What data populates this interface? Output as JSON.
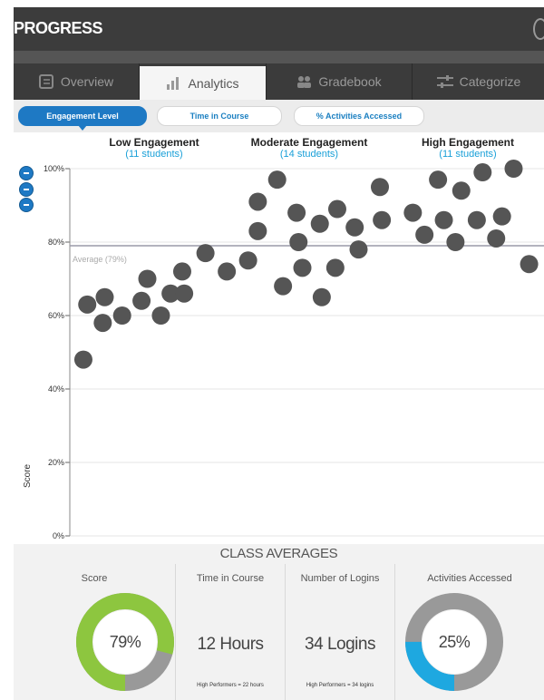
{
  "app": {
    "title": "PROGRESS"
  },
  "tabs": [
    {
      "label": "Overview",
      "icon": "overview-icon",
      "active": false
    },
    {
      "label": "Analytics",
      "icon": "bar-chart-icon",
      "active": true
    },
    {
      "label": "Gradebook",
      "icon": "people-icon",
      "active": false
    },
    {
      "label": "Categorize",
      "icon": "sliders-icon",
      "active": false
    }
  ],
  "filters": [
    {
      "label": "Engagement Level",
      "active": true
    },
    {
      "label": "Time in Course",
      "active": false
    },
    {
      "label": "% Activities Accessed",
      "active": false
    }
  ],
  "groups": [
    {
      "name": "Low Engagement",
      "count": "(11 students)"
    },
    {
      "name": "Moderate Engagement",
      "count": "(14 students)"
    },
    {
      "name": "High Engagement",
      "count": "(11 students)"
    }
  ],
  "chart_data": {
    "type": "scatter",
    "ylabel": "Score",
    "ylim": [
      0,
      100
    ],
    "yticks": [
      "100%",
      "80%",
      "60%",
      "40%",
      "20%",
      "0%"
    ],
    "average": {
      "label": "Average (79%)",
      "value": 79
    },
    "point_color": "#555555",
    "series": [
      {
        "group": "Low Engagement",
        "points": [
          {
            "x": 1,
            "y": 48
          },
          {
            "x": 1.2,
            "y": 63
          },
          {
            "x": 2,
            "y": 58
          },
          {
            "x": 2.1,
            "y": 65
          },
          {
            "x": 3,
            "y": 60
          },
          {
            "x": 4,
            "y": 64
          },
          {
            "x": 4.3,
            "y": 70
          },
          {
            "x": 5,
            "y": 60
          },
          {
            "x": 5.5,
            "y": 66
          },
          {
            "x": 6.1,
            "y": 72
          },
          {
            "x": 6.2,
            "y": 66
          },
          {
            "x": 7.3,
            "y": 77
          }
        ]
      },
      {
        "group": "Moderate Engagement",
        "points": [
          {
            "x": 8.4,
            "y": 72
          },
          {
            "x": 9.5,
            "y": 75
          },
          {
            "x": 10,
            "y": 91
          },
          {
            "x": 10,
            "y": 83
          },
          {
            "x": 11,
            "y": 97
          },
          {
            "x": 11.3,
            "y": 68
          },
          {
            "x": 12,
            "y": 88
          },
          {
            "x": 12.1,
            "y": 80
          },
          {
            "x": 12.3,
            "y": 73
          },
          {
            "x": 13.2,
            "y": 85
          },
          {
            "x": 13.3,
            "y": 65
          },
          {
            "x": 14.1,
            "y": 89
          },
          {
            "x": 14,
            "y": 73
          },
          {
            "x": 15,
            "y": 84
          },
          {
            "x": 15.2,
            "y": 78
          }
        ]
      },
      {
        "group": "High Engagement",
        "points": [
          {
            "x": 16.3,
            "y": 95
          },
          {
            "x": 16.4,
            "y": 86
          },
          {
            "x": 18,
            "y": 88
          },
          {
            "x": 18.6,
            "y": 82
          },
          {
            "x": 19.3,
            "y": 97
          },
          {
            "x": 19.6,
            "y": 86
          },
          {
            "x": 20.2,
            "y": 80
          },
          {
            "x": 20.5,
            "y": 94
          },
          {
            "x": 21.3,
            "y": 86
          },
          {
            "x": 21.6,
            "y": 99
          },
          {
            "x": 22.3,
            "y": 81
          },
          {
            "x": 22.6,
            "y": 87
          },
          {
            "x": 23.2,
            "y": 100
          },
          {
            "x": 24,
            "y": 74
          }
        ]
      }
    ]
  },
  "class_averages": {
    "title": "CLASS AVERAGES",
    "score": {
      "label": "Score",
      "value": "79%",
      "fraction": 0.79,
      "fill_color": "#8dc63f",
      "rest_color": "#999999"
    },
    "time": {
      "label": "Time in Course",
      "value": "12 Hours",
      "note": "High Performers = 22 hours"
    },
    "logins": {
      "label": "Number of Logins",
      "value": "34 Logins",
      "note": "High Performers = 34 logins"
    },
    "activities": {
      "label": "Activities Accessed",
      "value": "25%",
      "fraction": 0.25,
      "fill_color": "#1ea8e0",
      "rest_color": "#999999"
    }
  }
}
